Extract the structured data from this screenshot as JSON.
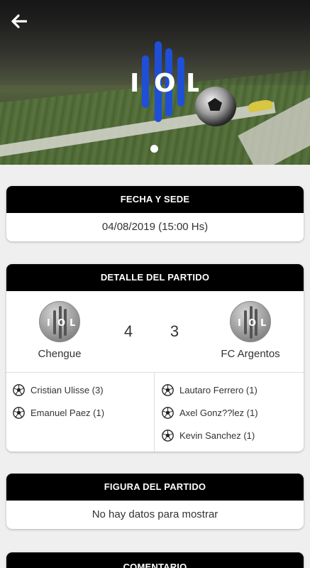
{
  "header": {
    "back_icon": "arrow-left-icon",
    "logo_text": [
      "I",
      "O",
      "L"
    ],
    "slide_count": 1
  },
  "fecha": {
    "title": "FECHA Y SEDE",
    "value": "04/08/2019 (15:00 Hs)"
  },
  "detalle": {
    "title": "DETALLE DEL PARTIDO",
    "home": {
      "name": "Chengue",
      "score": "4"
    },
    "away": {
      "name": "FC Argentos",
      "score": "3"
    },
    "home_scorers": [
      "Cristian Ulisse (3)",
      "Emanuel Paez (1)"
    ],
    "away_scorers": [
      "Lautaro Ferrero (1)",
      "Axel Gonz??lez (1)",
      "Kevin Sanchez (1)"
    ]
  },
  "figura": {
    "title": "FIGURA DEL PARTIDO",
    "value": "No hay datos para mostrar"
  },
  "comentario": {
    "title": "COMENTARIO"
  },
  "colors": {
    "accent": "#1f4fd6",
    "card_header": "#000000",
    "background": "#efefef"
  }
}
